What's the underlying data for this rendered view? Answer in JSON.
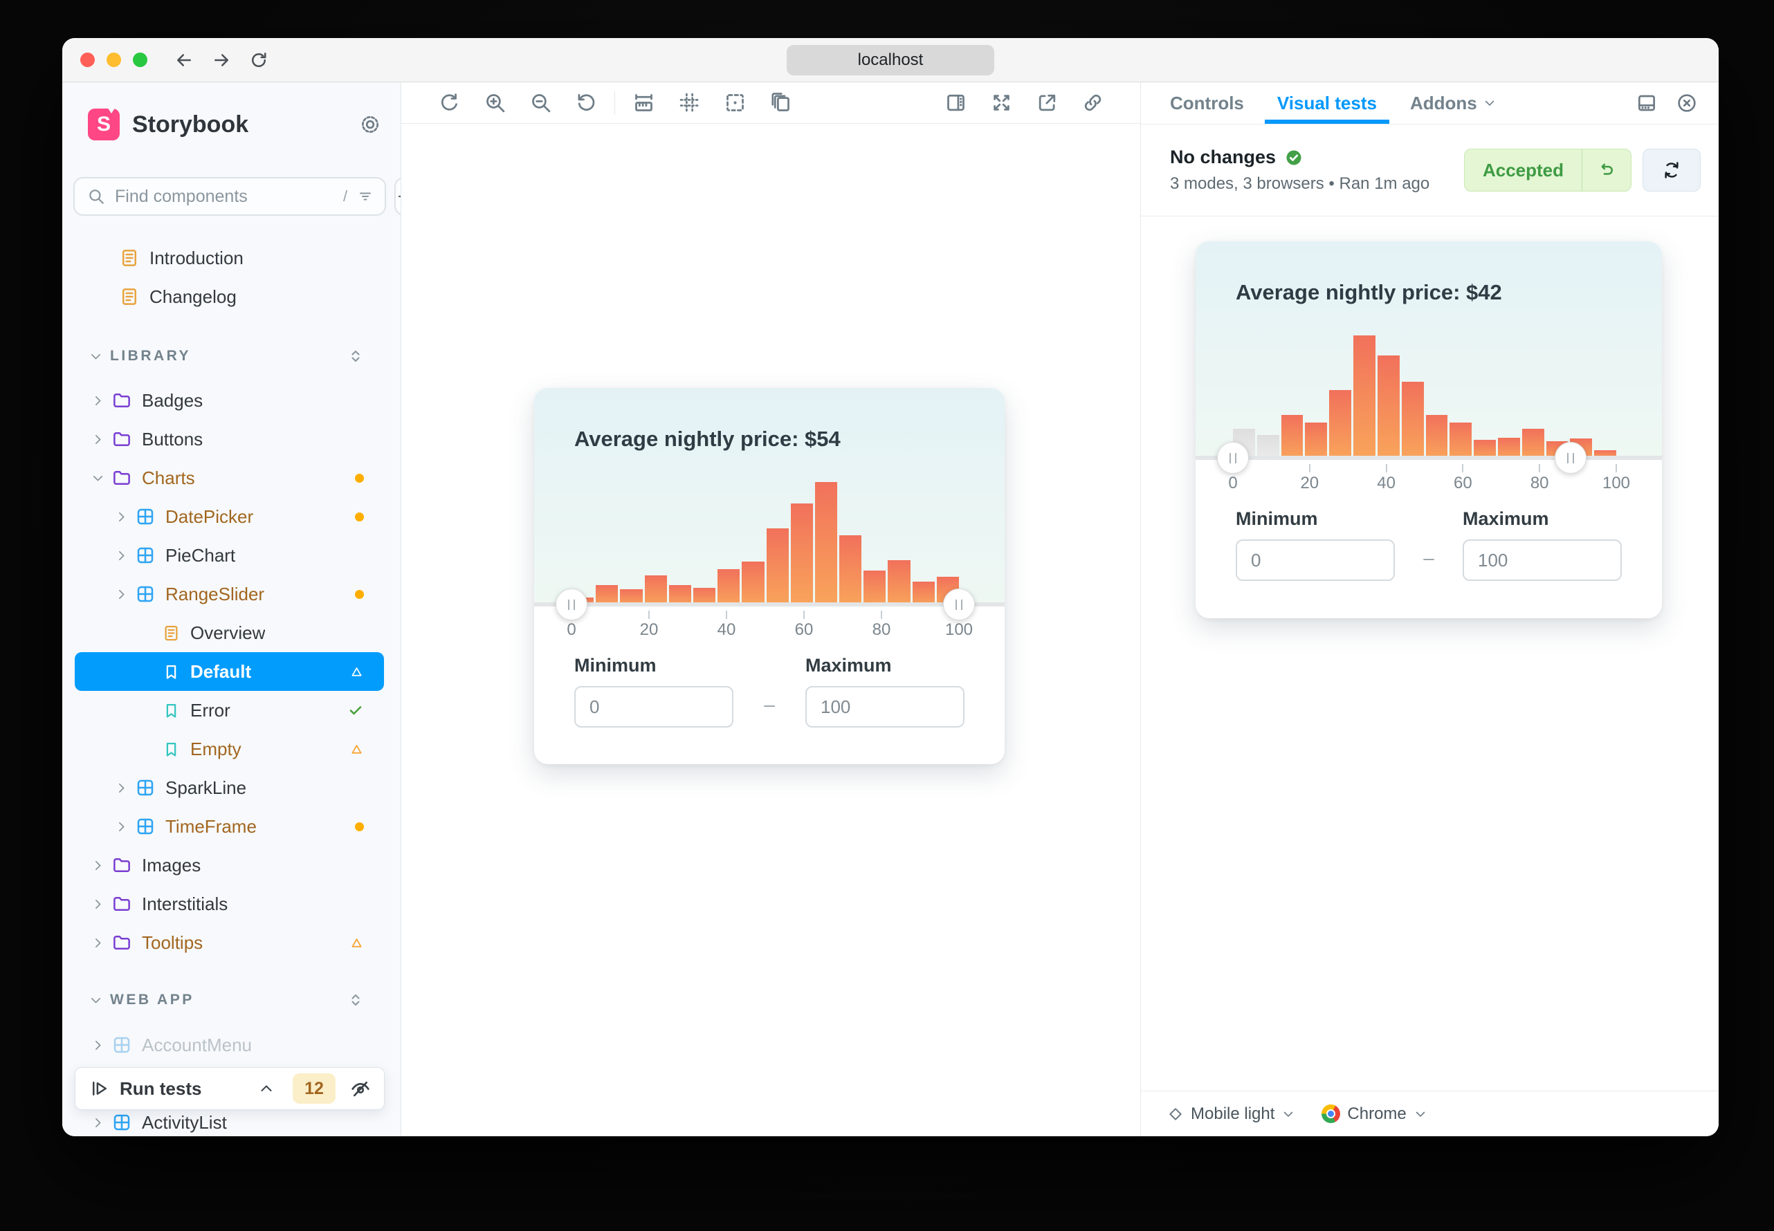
{
  "browser": {
    "url": "localhost"
  },
  "sidebar": {
    "brand": "Storybook",
    "logo_letter": "S",
    "search": {
      "placeholder": "Find components",
      "shortcut": "/"
    },
    "tree": [
      {
        "kind": "doc",
        "label": "Introduction",
        "icon": "doc-icon"
      },
      {
        "kind": "doc",
        "label": "Changelog",
        "icon": "doc-icon"
      },
      {
        "kind": "section",
        "label": "LIBRARY",
        "icon": "chevron-down-icon",
        "right_icon": "expand-collapse-icon",
        "spacer_before": 30
      },
      {
        "kind": "folder",
        "label": "Badges",
        "icon": "folder-icon",
        "chevron": "right",
        "spacer_before": 8
      },
      {
        "kind": "folder",
        "label": "Buttons",
        "icon": "folder-icon",
        "chevron": "right"
      },
      {
        "kind": "folder",
        "label": "Charts",
        "icon": "folder-icon",
        "chevron": "down",
        "highlighted": true,
        "badge": "dot"
      },
      {
        "kind": "component",
        "label": "DatePicker",
        "icon": "component-icon",
        "depth": 1,
        "chevron": "right",
        "highlighted": true,
        "badge": "dot"
      },
      {
        "kind": "component",
        "label": "PieChart",
        "icon": "component-icon",
        "depth": 1,
        "chevron": "right"
      },
      {
        "kind": "component",
        "label": "RangeSlider",
        "icon": "component-icon",
        "depth": 1,
        "chevron": "right",
        "highlighted": true,
        "badge": "dot"
      },
      {
        "kind": "story-doc",
        "label": "Overview",
        "icon": "doc-icon",
        "depth": 2
      },
      {
        "kind": "story",
        "label": "Default",
        "icon": "bookmark-icon",
        "depth": 2,
        "selected": true,
        "badge": "triangle-white"
      },
      {
        "kind": "story",
        "label": "Error",
        "icon": "bookmark-icon",
        "depth": 2,
        "badge": "check"
      },
      {
        "kind": "story",
        "label": "Empty",
        "icon": "bookmark-icon",
        "depth": 2,
        "highlighted": true,
        "badge": "triangle-orange"
      },
      {
        "kind": "component",
        "label": "SparkLine",
        "icon": "component-icon",
        "depth": 1,
        "chevron": "right"
      },
      {
        "kind": "component",
        "label": "TimeFrame",
        "icon": "component-icon",
        "depth": 1,
        "chevron": "right",
        "highlighted": true,
        "badge": "dot"
      },
      {
        "kind": "folder",
        "label": "Images",
        "icon": "folder-icon",
        "chevron": "right"
      },
      {
        "kind": "folder",
        "label": "Interstitials",
        "icon": "folder-icon",
        "chevron": "right"
      },
      {
        "kind": "folder",
        "label": "Tooltips",
        "icon": "folder-icon",
        "chevron": "right",
        "highlighted": true,
        "badge": "triangle-orange"
      },
      {
        "kind": "section",
        "label": "WEB APP",
        "icon": "chevron-down-icon",
        "right_icon": "expand-collapse-icon",
        "spacer_before": 27
      },
      {
        "kind": "component",
        "label": "AccountMenu",
        "icon": "component-icon",
        "depth": 0,
        "chevron": "right",
        "faded": true,
        "spacer_before": 9
      },
      {
        "kind": "component",
        "label": "ActivityList",
        "icon": "component-icon",
        "depth": 0,
        "chevron": "right",
        "spacer_before": 56
      }
    ],
    "run_tests": {
      "label": "Run tests",
      "count": "12",
      "icons": [
        "run-tests-icon",
        "chevron-up-icon",
        "watch-mode-icon"
      ]
    }
  },
  "canvas_toolbar": {
    "left_icons": [
      "remount-icon",
      "zoom-in-icon",
      "zoom-out-icon",
      "zoom-reset-icon"
    ],
    "middle_icons": [
      "measure-icon",
      "grid-icon",
      "outline-icon",
      "story-copies-icon"
    ],
    "right_icons": [
      "panel-right-icon",
      "fullscreen-icon",
      "open-external-icon",
      "link-icon"
    ]
  },
  "panel": {
    "tabs": [
      {
        "label": "Controls"
      },
      {
        "label": "Visual tests",
        "active": true
      },
      {
        "label": "Addons",
        "caret": true
      }
    ],
    "header_icons": [
      "panel-bottom-icon",
      "close-icon"
    ],
    "status": {
      "title": "No changes",
      "title_icon": "check-circle-icon",
      "subtitle": "3 modes, 3 browsers • Ran 1m ago"
    },
    "accepted_button": "Accepted",
    "footer": {
      "mode": "Mobile light",
      "browser": "Chrome"
    }
  },
  "chart_data": [
    {
      "type": "bar",
      "location": "canvas-preview",
      "title": "Average nightly price: $54",
      "values": [
        7,
        17,
        14,
        25,
        17,
        15,
        30,
        36,
        63,
        83,
        100,
        57,
        29,
        37,
        20,
        24
      ],
      "bin_range": [
        0,
        100
      ],
      "xticks": [
        "0",
        "20",
        "40",
        "60",
        "80",
        "100"
      ],
      "ylim": [
        0,
        100
      ],
      "gray_bars_left": 0,
      "slider_handles": [
        0,
        100
      ],
      "min": {
        "label": "Minimum",
        "value": "0"
      },
      "max": {
        "label": "Maximum",
        "value": "100"
      },
      "separator": "–"
    },
    {
      "type": "bar",
      "location": "visual-test-snapshot",
      "title": "Average nightly price: $42",
      "values": [
        25,
        20,
        36,
        30,
        56,
        100,
        84,
        63,
        36,
        30,
        16,
        18,
        25,
        15,
        17,
        8
      ],
      "bin_range": [
        0,
        100
      ],
      "xticks": [
        "0",
        "20",
        "40",
        "60",
        "80",
        "100"
      ],
      "ylim": [
        0,
        100
      ],
      "gray_bars_left": 2,
      "slider_handles": [
        0,
        88
      ],
      "min": {
        "label": "Minimum",
        "value": "0"
      },
      "max": {
        "label": "Maximum",
        "value": "100"
      },
      "separator": "–"
    }
  ],
  "colors": {
    "accent_blue": "#029CFD",
    "brand_pink": "#FF4785",
    "warning_orange": "#FFAE00",
    "changed_text": "#A2661F",
    "positive_green": "#43A047",
    "bar_gradient_top": "#F1715B",
    "bar_gradient_bottom": "#F9A55B",
    "accepted_bg": "#E4F6D4",
    "accepted_text": "#3E9B43",
    "traffic_red": "#FF5F57",
    "traffic_yellow": "#FEBD2E",
    "traffic_green": "#28C840"
  }
}
